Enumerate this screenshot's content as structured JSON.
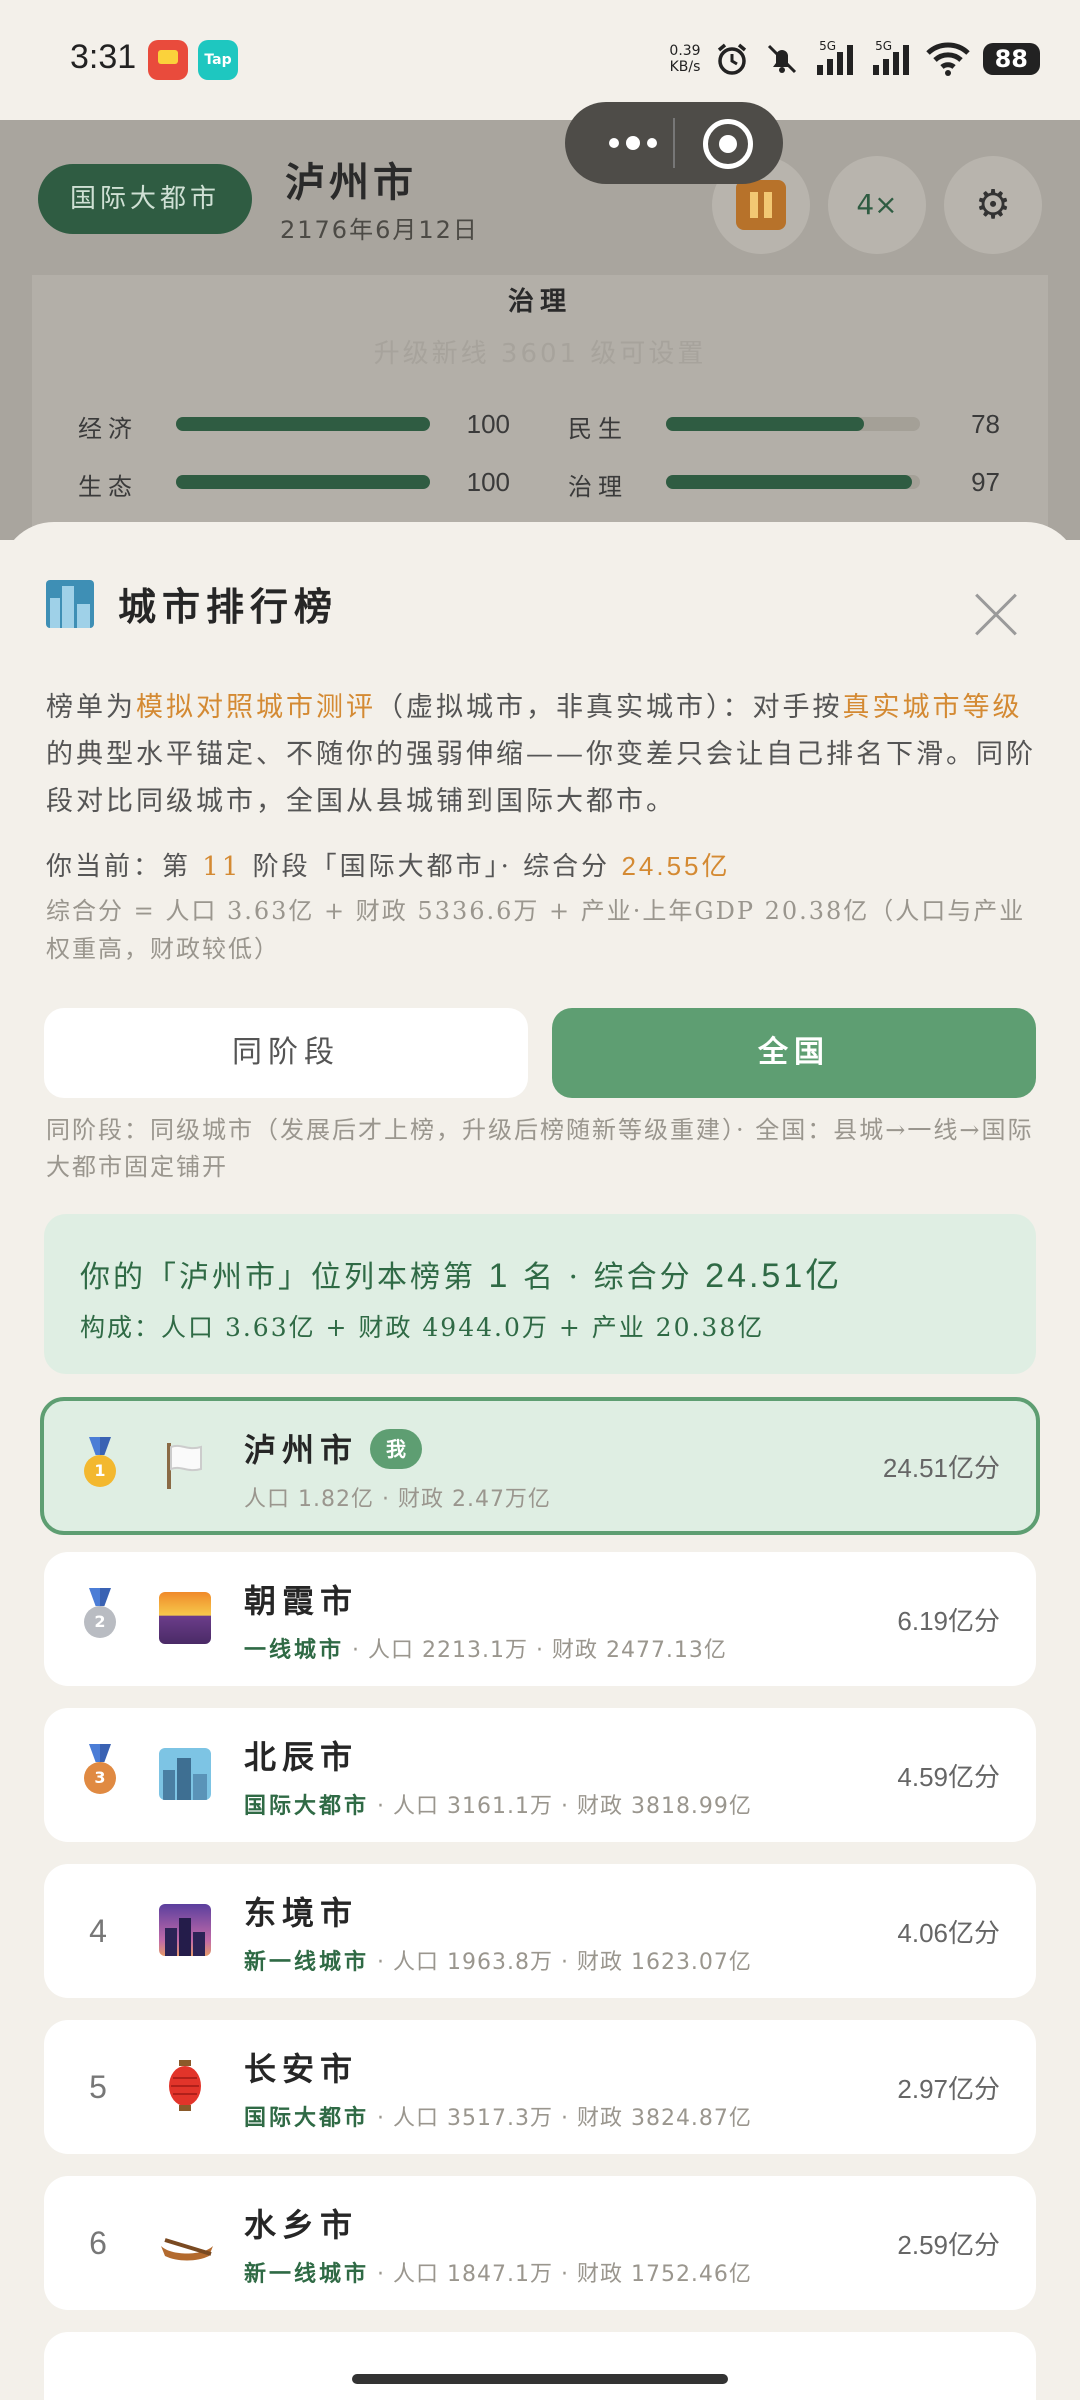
{
  "status_bar": {
    "time": "3:31",
    "net_speed_value": "0.39",
    "net_speed_unit": "KB/s",
    "signal1_label": "5G",
    "signal2_label": "5G",
    "battery": "88",
    "app2_label": "Tap"
  },
  "background": {
    "level_pill": "国际大都市",
    "city_name": "泸州市",
    "date": "2176年6月12日",
    "speed_label": "4×",
    "card_title": "治理",
    "card_subtitle": "升级新线 3601 级可设置",
    "stats": [
      {
        "label": "经济",
        "value": "100",
        "fraction": 1.0
      },
      {
        "label": "民生",
        "value": "78",
        "fraction": 0.78
      },
      {
        "label": "生态",
        "value": "100",
        "fraction": 1.0
      },
      {
        "label": "治理",
        "value": "97",
        "fraction": 0.97
      }
    ]
  },
  "sheet": {
    "title": "城市排行榜",
    "intro": {
      "p1": "榜单为",
      "hl1": "模拟对照城市测评",
      "p2": "（虚拟城市，非真实城市）：对手按",
      "hl2": "真实城市等级",
      "p3": "的典型水平锚定、不随你的强弱伸缩——你变差只会让自己排名下滑。同阶段对比同级城市，全国从县城铺到国际大都市。"
    },
    "current": {
      "prefix": "你当前：第",
      "stage": "11",
      "middle": "阶段「国际大都市」· 综合分",
      "score": "24.55亿"
    },
    "formula": "综合分 = 人口 3.63亿 + 财政 5336.6万 + 产业·上年GDP 20.38亿（人口与产业权重高，财政较低）",
    "tabs": {
      "same_stage": "同阶段",
      "national": "全国"
    },
    "tab_note": "同阶段：同级城市（发展后才上榜，升级后榜随新等级重建）· 全国：县城→一线→国际大都市固定铺开",
    "summary": {
      "main_prefix": "你的「泸州市」位列本榜第",
      "rank": "1",
      "main_mid": "名 · 综合分",
      "score": "24.51亿",
      "breakdown": "构成：人口 3.63亿 + 财政 4944.0万 + 产业 20.38亿"
    },
    "me_badge": "我",
    "rows": [
      {
        "rank": "1",
        "name": "泸州市",
        "tier": "",
        "sub": "人口 1.82亿 · 财政 2.47万亿",
        "score": "24.51亿分",
        "icon": "white-flag-icon"
      },
      {
        "rank": "2",
        "name": "朝霞市",
        "tier": "一线城市",
        "sub": "· 人口 2213.1万 · 财政 2477.13亿",
        "score": "6.19亿分",
        "icon": "sunrise-icon"
      },
      {
        "rank": "3",
        "name": "北辰市",
        "tier": "国际大都市",
        "sub": "· 人口 3161.1万 · 财政 3818.99亿",
        "score": "4.59亿分",
        "icon": "cityscape-icon"
      },
      {
        "rank": "4",
        "name": "东境市",
        "tier": "新一线城市",
        "sub": "· 人口 1963.8万 · 财政 1623.07亿",
        "score": "4.06亿分",
        "icon": "city-dusk-icon"
      },
      {
        "rank": "5",
        "name": "长安市",
        "tier": "国际大都市",
        "sub": "· 人口 3517.3万 · 财政 3824.87亿",
        "score": "2.97亿分",
        "icon": "lantern-icon"
      },
      {
        "rank": "6",
        "name": "水乡市",
        "tier": "新一线城市",
        "sub": "· 人口 1847.1万 · 财政 1752.46亿",
        "score": "2.59亿分",
        "icon": "canoe-icon"
      }
    ]
  },
  "colors": {
    "accent_green": "#5e9e72",
    "highlight_orange": "#d48a33",
    "dark_green": "#2f5c42"
  }
}
